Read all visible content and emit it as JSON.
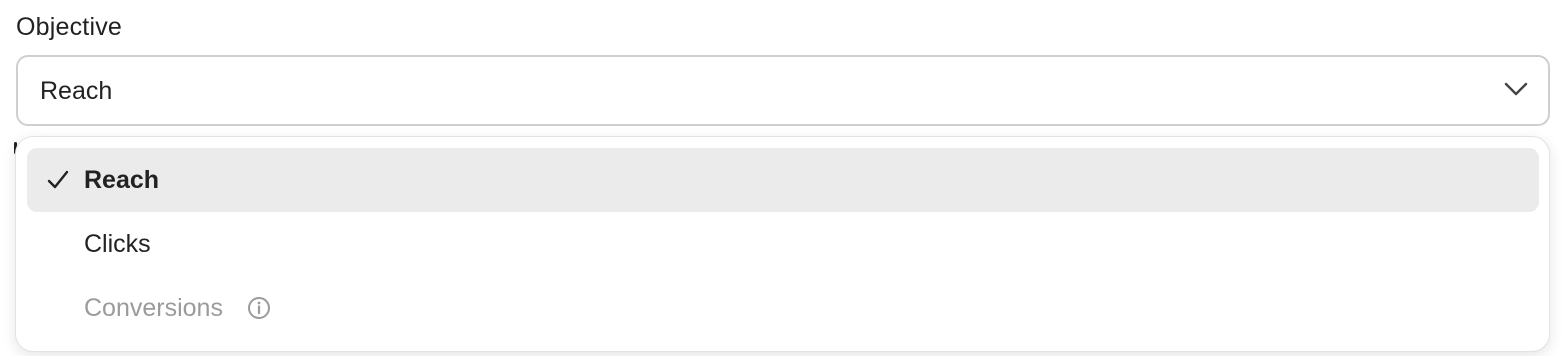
{
  "field": {
    "label": "Objective",
    "selected_value": "Reach",
    "toggle_icon": "chevron-down-icon"
  },
  "dropdown": {
    "options": [
      {
        "label": "Reach",
        "state": "selected",
        "icon": "check-icon"
      },
      {
        "label": "Clicks",
        "state": "enabled"
      },
      {
        "label": "Conversions",
        "state": "disabled",
        "icon": "info-icon"
      }
    ]
  },
  "colors": {
    "highlight": "#ebebeb",
    "disabled_text": "#9b9b9b",
    "text": "#222222",
    "border": "#cfcfcf"
  }
}
